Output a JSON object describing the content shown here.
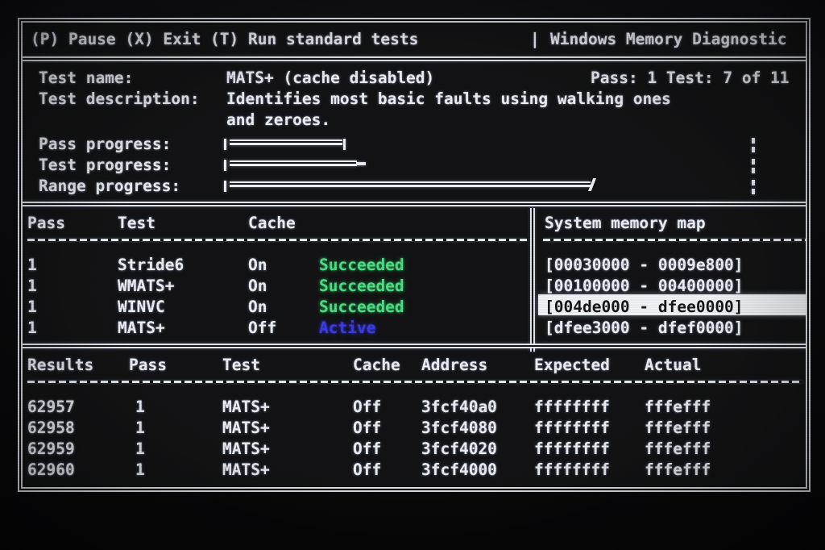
{
  "app": {
    "title": "Windows Memory Diagnostic",
    "title_prefix": "|",
    "menu_hotkeys": "(P) Pause (X) Exit (T) Run standard tests"
  },
  "colors": {
    "foreground": "#eef0f4",
    "background": "#131314",
    "success": "#4ee084",
    "active": "#3b3bee",
    "highlight_bg": "#f2f4f8",
    "highlight_fg": "#16161a"
  },
  "info": {
    "test_name_label": "Test name:",
    "test_name_value": "MATS+ (cache disabled)",
    "test_description_label": "Test description:",
    "test_description_line1": "Identifies most basic faults using walking ones",
    "test_description_line2": "and zeroes.",
    "pass_counter": "Pass: 1 Test: 7 of 11"
  },
  "progress": {
    "pass_label": "Pass progress:",
    "test_label": "Test progress:",
    "range_label": "Range progress:",
    "pass_percent": 22,
    "test_percent": 24,
    "range_percent": 68,
    "pass_end_marker": "|",
    "test_end_marker": "-",
    "range_end_marker": "/"
  },
  "status_table": {
    "headers": [
      "Pass",
      "Test",
      "Cache",
      ""
    ],
    "rows": [
      {
        "pass": "1",
        "test": "Stride6",
        "cache": "On",
        "status": "Succeeded",
        "status_color": "success"
      },
      {
        "pass": "1",
        "test": "WMATS+",
        "cache": "On",
        "status": "Succeeded",
        "status_color": "success"
      },
      {
        "pass": "1",
        "test": "WINVC",
        "cache": "On",
        "status": "Succeeded",
        "status_color": "success"
      },
      {
        "pass": "1",
        "test": "MATS+",
        "cache": "Off",
        "status": "Active",
        "status_color": "active"
      }
    ]
  },
  "memory_map": {
    "title": "System memory map",
    "entries": [
      {
        "range": "[00030000 - 0009e800]",
        "selected": false
      },
      {
        "range": "[00100000 - 00400000]",
        "selected": false
      },
      {
        "range": "[004de000 - dfee0000]",
        "selected": true
      },
      {
        "range": "[dfee3000 - dfef0000]",
        "selected": false
      }
    ]
  },
  "results_table": {
    "headers": [
      "Results",
      "Pass",
      "Test",
      "Cache",
      "Address",
      "Expected",
      "Actual"
    ],
    "rows": [
      {
        "results": "62957",
        "pass": "1",
        "test": "MATS+",
        "cache": "Off",
        "address": "3fcf40a0",
        "expected": "ffffffff",
        "actual": "fffefff"
      },
      {
        "results": "62958",
        "pass": "1",
        "test": "MATS+",
        "cache": "Off",
        "address": "3fcf4080",
        "expected": "ffffffff",
        "actual": "fffefff"
      },
      {
        "results": "62959",
        "pass": "1",
        "test": "MATS+",
        "cache": "Off",
        "address": "3fcf4020",
        "expected": "ffffffff",
        "actual": "fffefff"
      },
      {
        "results": "62960",
        "pass": "1",
        "test": "MATS+",
        "cache": "Off",
        "address": "3fcf4000",
        "expected": "ffffffff",
        "actual": "fffefff"
      }
    ]
  }
}
